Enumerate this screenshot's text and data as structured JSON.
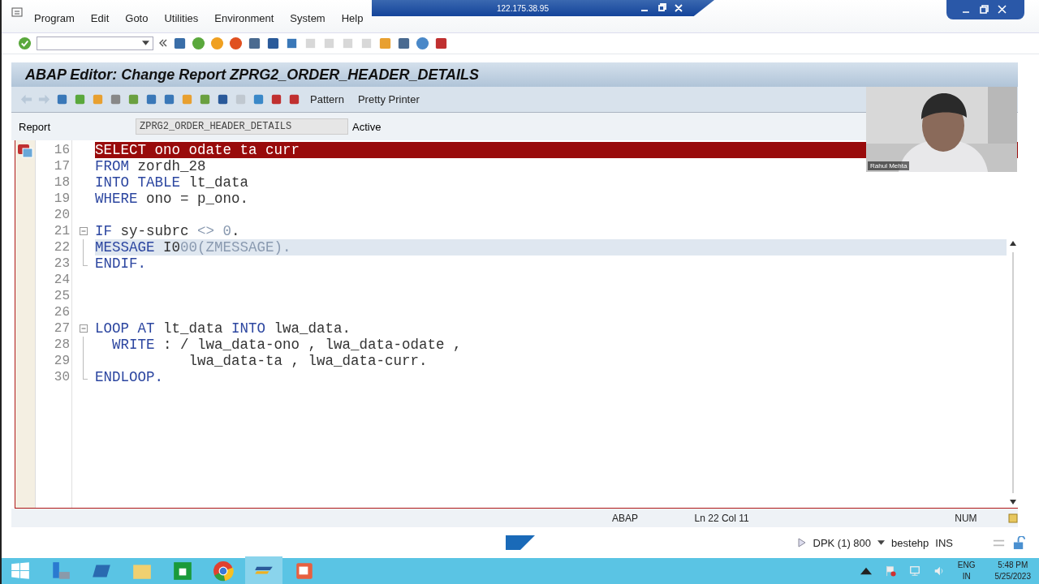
{
  "remote_bar": {
    "address": "122.175.38.95"
  },
  "menu": [
    "Program",
    "Edit",
    "Goto",
    "Utilities",
    "Environment",
    "System",
    "Help"
  ],
  "title": "ABAP Editor: Change Report ZPRG2_ORDER_HEADER_DETAILS",
  "app_toolbar": {
    "buttons": [
      "Pattern",
      "Pretty Printer"
    ]
  },
  "report": {
    "label": "Report",
    "value": "ZPRG2_ORDER_HEADER_DETAILS",
    "status": "Active"
  },
  "editor": {
    "lines": [
      {
        "number": "16",
        "error": true,
        "current": false,
        "collapsible": false,
        "in_block": false,
        "block_end": false,
        "tokens": [
          {
            "kind": "keyword",
            "text": "SELECT"
          },
          {
            "kind": "text",
            "text": " ono odate ta curr"
          }
        ]
      },
      {
        "number": "17",
        "error": false,
        "current": false,
        "collapsible": false,
        "in_block": false,
        "block_end": false,
        "tokens": [
          {
            "kind": "keyword",
            "text": "FROM"
          },
          {
            "kind": "text",
            "text": " zordh_28"
          }
        ]
      },
      {
        "number": "18",
        "error": false,
        "current": false,
        "collapsible": false,
        "in_block": false,
        "block_end": false,
        "tokens": [
          {
            "kind": "keyword",
            "text": "INTO TABLE"
          },
          {
            "kind": "text",
            "text": " lt_data"
          }
        ]
      },
      {
        "number": "19",
        "error": false,
        "current": false,
        "collapsible": false,
        "in_block": false,
        "block_end": false,
        "tokens": [
          {
            "kind": "keyword",
            "text": "WHERE"
          },
          {
            "kind": "text",
            "text": " ono = p_ono."
          }
        ]
      },
      {
        "number": "20",
        "error": false,
        "current": false,
        "collapsible": false,
        "in_block": false,
        "block_end": false
      },
      {
        "number": "21",
        "error": false,
        "current": false,
        "collapsible": true,
        "in_block": false,
        "block_end": false,
        "tokens": [
          {
            "kind": "keyword",
            "text": "IF"
          },
          {
            "kind": "text",
            "text": " sy-subrc "
          },
          {
            "kind": "literal",
            "text": "<> 0"
          },
          {
            "kind": "text",
            "text": "."
          }
        ]
      },
      {
        "number": "22",
        "error": false,
        "current": true,
        "collapsible": false,
        "in_block": true,
        "block_end": false,
        "tokens": [
          {
            "kind": "keyword",
            "text": "MESSAGE"
          },
          {
            "kind": "text",
            "text": " I0"
          },
          {
            "kind": "literal",
            "text": "00(ZMESSAGE)."
          }
        ]
      },
      {
        "number": "23",
        "error": false,
        "current": false,
        "collapsible": false,
        "in_block": false,
        "block_end": true,
        "tokens": [
          {
            "kind": "keyword",
            "text": "ENDIF."
          }
        ]
      },
      {
        "number": "24",
        "error": false,
        "current": false,
        "collapsible": false,
        "in_block": false,
        "block_end": false
      },
      {
        "number": "25",
        "error": false,
        "current": false,
        "collapsible": false,
        "in_block": false,
        "block_end": false
      },
      {
        "number": "26",
        "error": false,
        "current": false,
        "collapsible": false,
        "in_block": false,
        "block_end": false
      },
      {
        "number": "27",
        "error": false,
        "current": false,
        "collapsible": true,
        "in_block": false,
        "block_end": false,
        "tokens": [
          {
            "kind": "keyword",
            "text": "LOOP AT"
          },
          {
            "kind": "text",
            "text": " lt_data "
          },
          {
            "kind": "keyword",
            "text": "INTO"
          },
          {
            "kind": "text",
            "text": " lwa_data."
          }
        ]
      },
      {
        "number": "28",
        "error": false,
        "current": false,
        "collapsible": false,
        "in_block": true,
        "block_end": false,
        "tokens": [
          {
            "kind": "keyword",
            "text": "  WRITE"
          },
          {
            "kind": "text",
            "text": " : / lwa_data-ono , lwa_data-odate ,"
          }
        ]
      },
      {
        "number": "29",
        "error": false,
        "current": false,
        "collapsible": false,
        "in_block": true,
        "block_end": false,
        "tokens": [
          {
            "kind": "text",
            "text": "           lwa_data-ta , lwa_data-curr."
          }
        ]
      },
      {
        "number": "30",
        "error": false,
        "current": false,
        "collapsible": false,
        "in_block": false,
        "block_end": true,
        "tokens": [
          {
            "kind": "keyword",
            "text": "ENDLOOP."
          }
        ]
      }
    ]
  },
  "status": {
    "language": "ABAP",
    "position": "Ln  22 Col  11",
    "mode": "NUM"
  },
  "sap_bar": {
    "system": "DPK (1) 800",
    "server": "bestehp",
    "mode": "INS"
  },
  "webcam": {
    "name": "Rahul Mehta"
  },
  "taskbar": {
    "lang": "ENG",
    "region": "IN",
    "time": "5:48 PM",
    "date": "5/25/2023"
  }
}
